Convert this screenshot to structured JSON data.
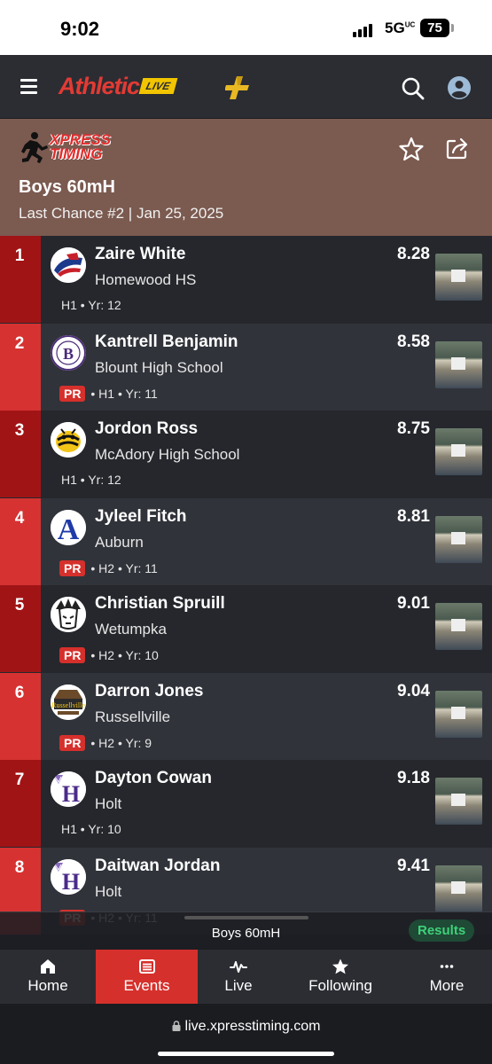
{
  "status_bar": {
    "time": "9:02",
    "network": "5G",
    "network_suffix": "UC",
    "battery": "75"
  },
  "app": {
    "brand": "Athletic",
    "brand_tag": "LIVE"
  },
  "org": {
    "logo_text_line1": "XPRESS",
    "logo_text_line2": "TIMING"
  },
  "event": {
    "title": "Boys 60mH",
    "subtitle": "Last Chance #2 | Jan 25, 2025"
  },
  "results": [
    {
      "place": "1",
      "name": "Zaire White",
      "school": "Homewood HS",
      "pr": false,
      "heat": "H1",
      "year": "Yr: 12",
      "mark": "8.28",
      "logo": "homewood-logo"
    },
    {
      "place": "2",
      "name": "Kantrell Benjamin",
      "school": "Blount High School",
      "pr": true,
      "heat": "H1",
      "year": "Yr: 11",
      "mark": "8.58",
      "logo": "blount-logo"
    },
    {
      "place": "3",
      "name": "Jordon Ross",
      "school": "McAdory High School",
      "pr": false,
      "heat": "H1",
      "year": "Yr: 12",
      "mark": "8.75",
      "logo": "mcadory-logo"
    },
    {
      "place": "4",
      "name": "Jyleel Fitch",
      "school": "Auburn",
      "pr": true,
      "heat": "H2",
      "year": "Yr: 11",
      "mark": "8.81",
      "logo": "auburn-logo"
    },
    {
      "place": "5",
      "name": "Christian Spruill",
      "school": "Wetumpka",
      "pr": true,
      "heat": "H2",
      "year": "Yr: 10",
      "mark": "9.01",
      "logo": "wetumpka-logo"
    },
    {
      "place": "6",
      "name": "Darron Jones",
      "school": "Russellville",
      "pr": true,
      "heat": "H2",
      "year": "Yr: 9",
      "mark": "9.04",
      "logo": "russellville-logo"
    },
    {
      "place": "7",
      "name": "Dayton Cowan",
      "school": "Holt",
      "pr": false,
      "heat": "H1",
      "year": "Yr: 10",
      "mark": "9.18",
      "logo": "holt-logo"
    },
    {
      "place": "8",
      "name": "Daitwan Jordan",
      "school": "Holt",
      "pr": true,
      "heat": "H2",
      "year": "Yr: 11",
      "mark": "9.41",
      "logo": "holt-logo"
    }
  ],
  "pr_label": "PR",
  "meta_separator": "•",
  "mini_bar": {
    "label": "Boys 60mH",
    "button": "Results"
  },
  "tabs": [
    {
      "label": "Home",
      "icon": "home-icon"
    },
    {
      "label": "Events",
      "icon": "list-icon",
      "active": true
    },
    {
      "label": "Live",
      "icon": "pulse-icon"
    },
    {
      "label": "Following",
      "icon": "star-icon"
    },
    {
      "label": "More",
      "icon": "more-icon"
    }
  ],
  "browser": {
    "url": "live.xpresstiming.com"
  },
  "colors": {
    "place_dark": "#a11416",
    "place_light": "#d63232",
    "header_bg": "#7b5a50",
    "accent_red": "#d6302c",
    "results_green": "#3fd07a"
  }
}
